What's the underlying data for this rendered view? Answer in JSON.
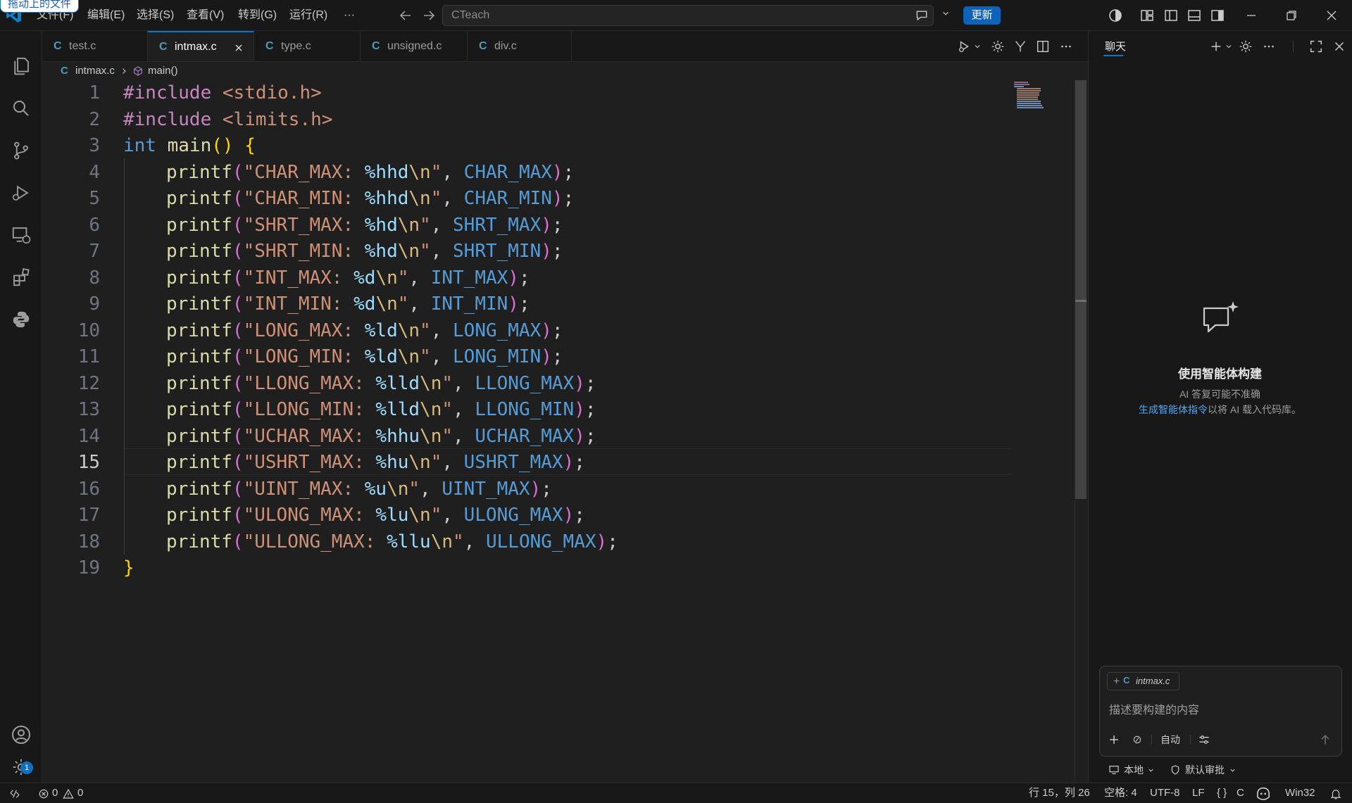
{
  "tooltip": "拖动上的文件",
  "menu": [
    "文件(F)",
    "编辑(E)",
    "选择(S)",
    "查看(V)",
    "转到(G)",
    "运行(R)",
    "···"
  ],
  "command_center": {
    "text": "CTeach"
  },
  "update_label": "更新",
  "tabs": [
    {
      "label": "test.c",
      "icon": "C"
    },
    {
      "label": "intmax.c",
      "icon": "C",
      "active": true
    },
    {
      "label": "type.c",
      "icon": "C"
    },
    {
      "label": "unsigned.c",
      "icon": "C"
    },
    {
      "label": "div.c",
      "icon": "C"
    }
  ],
  "breadcrumb": {
    "file": "intmax.c",
    "symbol": "main()"
  },
  "line_numbers": [
    "1",
    "2",
    "3",
    "4",
    "5",
    "6",
    "7",
    "8",
    "9",
    "10",
    "11",
    "12",
    "13",
    "14",
    "15",
    "16",
    "17",
    "18",
    "19"
  ],
  "current_line": "15",
  "code": {
    "l1": {
      "a": "#include",
      "b": "<stdio.h>"
    },
    "l2": {
      "a": "#include",
      "b": "<limits.h>"
    },
    "l3": {
      "a": "int",
      "b": "main",
      "c": "()",
      "d": "{"
    },
    "lines": [
      {
        "fn": "printf",
        "str": "\"CHAR_MAX: ",
        "fmt": "%hhd",
        "esc": "\\n",
        "q": "\"",
        "mac": "CHAR_MAX"
      },
      {
        "fn": "printf",
        "str": "\"CHAR_MIN: ",
        "fmt": "%hhd",
        "esc": "\\n",
        "q": "\"",
        "mac": "CHAR_MIN"
      },
      {
        "fn": "printf",
        "str": "\"SHRT_MAX: ",
        "fmt": "%hd",
        "esc": "\\n",
        "q": "\"",
        "mac": "SHRT_MAX"
      },
      {
        "fn": "printf",
        "str": "\"SHRT_MIN: ",
        "fmt": "%hd",
        "esc": "\\n",
        "q": "\"",
        "mac": "SHRT_MIN"
      },
      {
        "fn": "printf",
        "str": "\"INT_MAX: ",
        "fmt": "%d",
        "esc": "\\n",
        "q": "\"",
        "mac": "INT_MAX"
      },
      {
        "fn": "printf",
        "str": "\"INT_MIN: ",
        "fmt": "%d",
        "esc": "\\n",
        "q": "\"",
        "mac": "INT_MIN"
      },
      {
        "fn": "printf",
        "str": "\"LONG_MAX: ",
        "fmt": "%ld",
        "esc": "\\n",
        "q": "\"",
        "mac": "LONG_MAX"
      },
      {
        "fn": "printf",
        "str": "\"LONG_MIN: ",
        "fmt": "%ld",
        "esc": "\\n",
        "q": "\"",
        "mac": "LONG_MIN"
      },
      {
        "fn": "printf",
        "str": "\"LLONG_MAX: ",
        "fmt": "%lld",
        "esc": "\\n",
        "q": "\"",
        "mac": "LLONG_MAX"
      },
      {
        "fn": "printf",
        "str": "\"LLONG_MIN: ",
        "fmt": "%lld",
        "esc": "\\n",
        "q": "\"",
        "mac": "LLONG_MIN"
      },
      {
        "fn": "printf",
        "str": "\"UCHAR_MAX: ",
        "fmt": "%hhu",
        "esc": "\\n",
        "q": "\"",
        "mac": "UCHAR_MAX"
      },
      {
        "fn": "printf",
        "str": "\"USHRT_MAX: ",
        "fmt": "%hu",
        "esc": "\\n",
        "q": "\"",
        "mac": "USHRT_MAX"
      },
      {
        "fn": "printf",
        "str": "\"UINT_MAX: ",
        "fmt": "%u",
        "esc": "\\n",
        "q": "\"",
        "mac": "UINT_MAX"
      },
      {
        "fn": "printf",
        "str": "\"ULONG_MAX: ",
        "fmt": "%lu",
        "esc": "\\n",
        "q": "\"",
        "mac": "ULONG_MAX"
      },
      {
        "fn": "printf",
        "str": "\"ULLONG_MAX: ",
        "fmt": "%llu",
        "esc": "\\n",
        "q": "\"",
        "mac": "ULLONG_MAX"
      }
    ],
    "close": "}"
  },
  "chat": {
    "tab_label": "聊天",
    "title": "使用智能体构建",
    "subtitle": "AI 答复可能不准确",
    "hint_link": "生成智能体指令",
    "hint_rest": "以将 AI 载入代码库。",
    "context_file": "intmax.c",
    "placeholder": "描述要构建的内容",
    "mode": "自动",
    "location": "本地",
    "approval": "默认审批"
  },
  "status": {
    "errors": "0",
    "warnings": "0",
    "position": "行 15，列 26",
    "indent": "空格: 4",
    "encoding": "UTF-8",
    "eol": "LF",
    "language": "C",
    "platform": "Win32",
    "settings_badge": "1"
  },
  "colors": {
    "accent": "#0078d4",
    "keyword": "#c586c0",
    "string": "#ce9178",
    "function": "#dcdcaa",
    "macro": "#569cd6",
    "bracket": "#ffd700"
  }
}
